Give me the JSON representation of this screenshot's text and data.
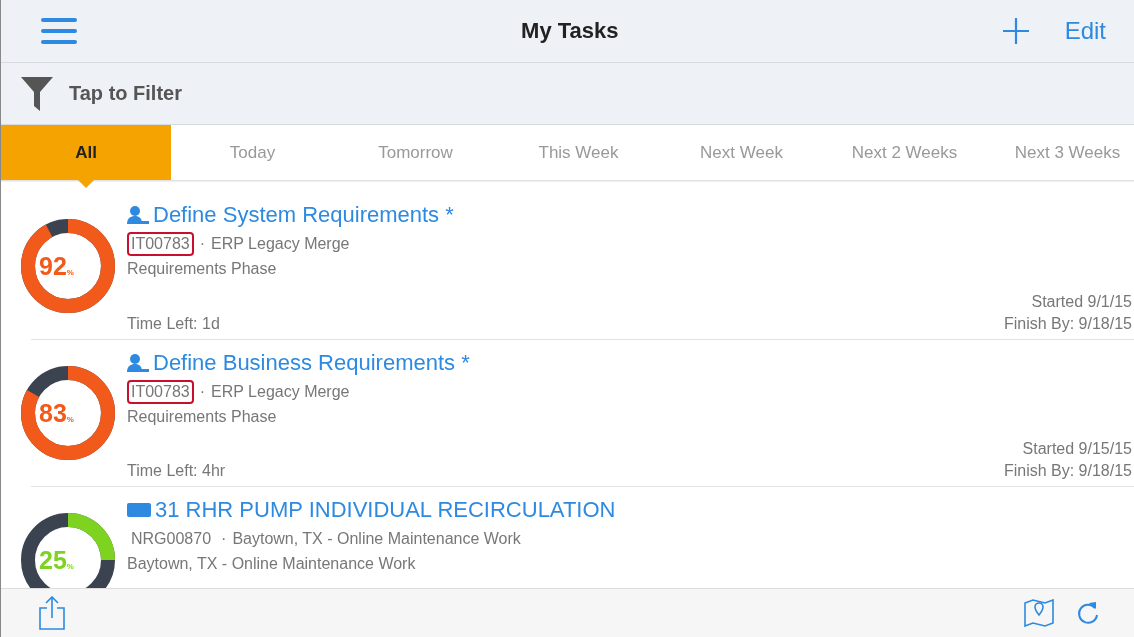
{
  "nav_bar": {
    "title": "My Tasks",
    "edit_label": "Edit"
  },
  "filter_bar": {
    "label": "Tap to Filter"
  },
  "tabs": [
    {
      "label": "All",
      "selected": true
    },
    {
      "label": "Today",
      "selected": false
    },
    {
      "label": "Tomorrow",
      "selected": false
    },
    {
      "label": "This Week",
      "selected": false
    },
    {
      "label": "Next Week",
      "selected": false
    },
    {
      "label": "Next 2 Weeks",
      "selected": false
    },
    {
      "label": "Next 3 Weeks",
      "selected": false
    }
  ],
  "tasks": [
    {
      "kind": "person",
      "title": "Define System Requirements *",
      "level": 0.92,
      "percent": "92",
      "percent_sign": "%",
      "color": "#f25a1c",
      "id": "IT00783",
      "id_highlighted": true,
      "project": "ERP Legacy Merge",
      "separator": "·",
      "phase": "Requirements Phase",
      "time_left": "Time Left: 1d",
      "started": "Started 9/1/15",
      "finish_by": "Finish By: 9/18/15"
    },
    {
      "kind": "person",
      "title": "Define Business Requirements *",
      "level": 0.83,
      "percent": "83",
      "percent_sign": "%",
      "color": "#f25a1c",
      "id": "IT00783",
      "id_highlighted": true,
      "project": "ERP Legacy Merge",
      "separator": "·",
      "phase": "Requirements Phase",
      "time_left": "Time Left: 4hr",
      "started": "Started 9/15/15",
      "finish_by": "Finish By: 9/18/15"
    },
    {
      "kind": "work-order",
      "title": "31 RHR PUMP INDIVIDUAL RECIRCULATION",
      "level": 0.25,
      "percent": "25",
      "percent_sign": "%",
      "color": "#7ed321",
      "id": "NRG00870",
      "id_highlighted": false,
      "project": "Baytown, TX - Online Maintenance Work",
      "separator": "·",
      "phase": "Baytown, TX - Online Maintenance Work"
    }
  ]
}
